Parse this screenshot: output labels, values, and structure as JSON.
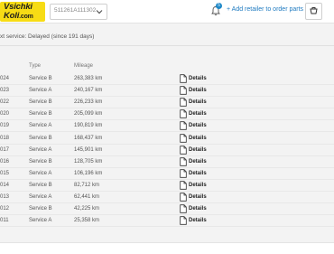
{
  "header": {
    "logo_line1": "Vsichki",
    "logo_line2": "Koli",
    "logo_suffix": ".com",
    "vin": "511261A111302",
    "notification_count": "5",
    "add_retailer_label": "Add retailer to order parts"
  },
  "summary": {
    "next_service_text": "xt service: Delayed (since 191 days)"
  },
  "table": {
    "columns": [
      "Type",
      "Mileage"
    ],
    "details_label": "Details",
    "rows": [
      {
        "year": "024",
        "type": "Service B",
        "mileage": "263,383 km"
      },
      {
        "year": "023",
        "type": "Service A",
        "mileage": "240,167 km"
      },
      {
        "year": "022",
        "type": "Service B",
        "mileage": "226,233 km"
      },
      {
        "year": "020",
        "type": "Service B",
        "mileage": "205,099 km"
      },
      {
        "year": "019",
        "type": "Service A",
        "mileage": "190,819 km"
      },
      {
        "year": "018",
        "type": "Service B",
        "mileage": "168,437 km"
      },
      {
        "year": "017",
        "type": "Service A",
        "mileage": "145,901 km"
      },
      {
        "year": "016",
        "type": "Service B",
        "mileage": "128,705 km"
      },
      {
        "year": "015",
        "type": "Service A",
        "mileage": "106,196 km"
      },
      {
        "year": "014",
        "type": "Service B",
        "mileage": "82,712 km"
      },
      {
        "year": "013",
        "type": "Service A",
        "mileage": "62,441 km"
      },
      {
        "year": "012",
        "type": "Service B",
        "mileage": "42,225 km"
      },
      {
        "year": "011",
        "type": "Service A",
        "mileage": "25,358 km"
      }
    ]
  }
}
